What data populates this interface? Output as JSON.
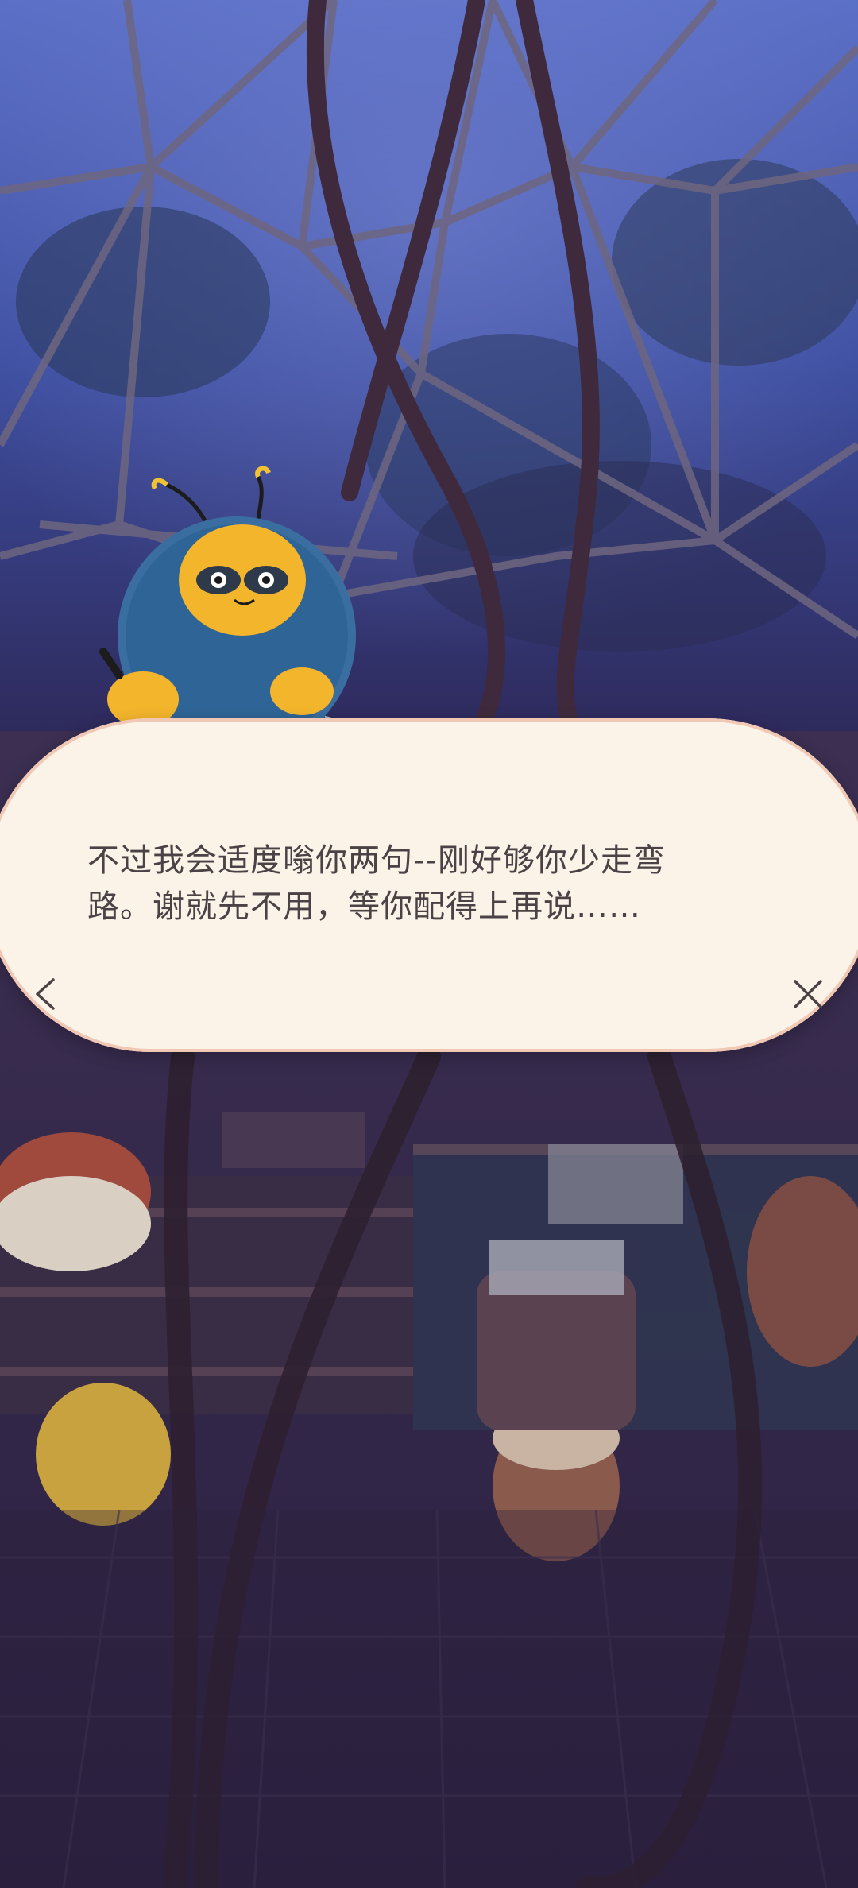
{
  "dialog": {
    "line1": "不过我会适度嗡你两句--刚好够你少走弯",
    "line2": "路。谢就先不用，等你配得上再说……"
  },
  "icons": {
    "back": "chevron-left-icon",
    "close": "close-icon"
  },
  "colors": {
    "dialog_bg": "#fbf2e8",
    "dialog_border": "#f0c8b4",
    "text": "#4a4244",
    "sky": "#4a5bb0",
    "room": "#3a2c4a"
  }
}
